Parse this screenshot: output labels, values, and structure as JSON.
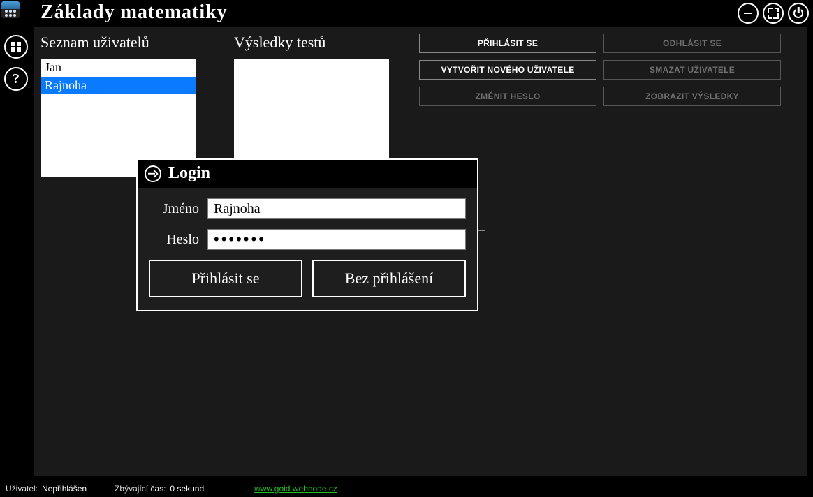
{
  "app": {
    "title": "Základy matematiky"
  },
  "sections": {
    "users_title": "Seznam uživatelů",
    "results_title": "Výsledky testů"
  },
  "users": [
    {
      "name": "Jan",
      "selected": false
    },
    {
      "name": "Rajnoha",
      "selected": true
    }
  ],
  "results": [],
  "actions": {
    "login": "Přihlásit se",
    "logout": "Odhlásit se",
    "new_user": "Vytvořit nového uživatele",
    "delete_user": "Smazat uživatele",
    "change_password": "Změnit heslo",
    "show_results": "Zobrazit výsledky"
  },
  "dialog": {
    "title": "Login",
    "name_label": "Jméno",
    "password_label": "Heslo",
    "name_value": "Rajnoha",
    "password_value": "•••••••",
    "submit": "Přihlásit se",
    "skip": "Bez přihlášení"
  },
  "status": {
    "user_label": "Uživatel:",
    "user_value": "Nepřihlášen",
    "time_label": "Zbývající čas:",
    "time_value": "0 sekund",
    "link": "www.goid.webnode.cz"
  }
}
